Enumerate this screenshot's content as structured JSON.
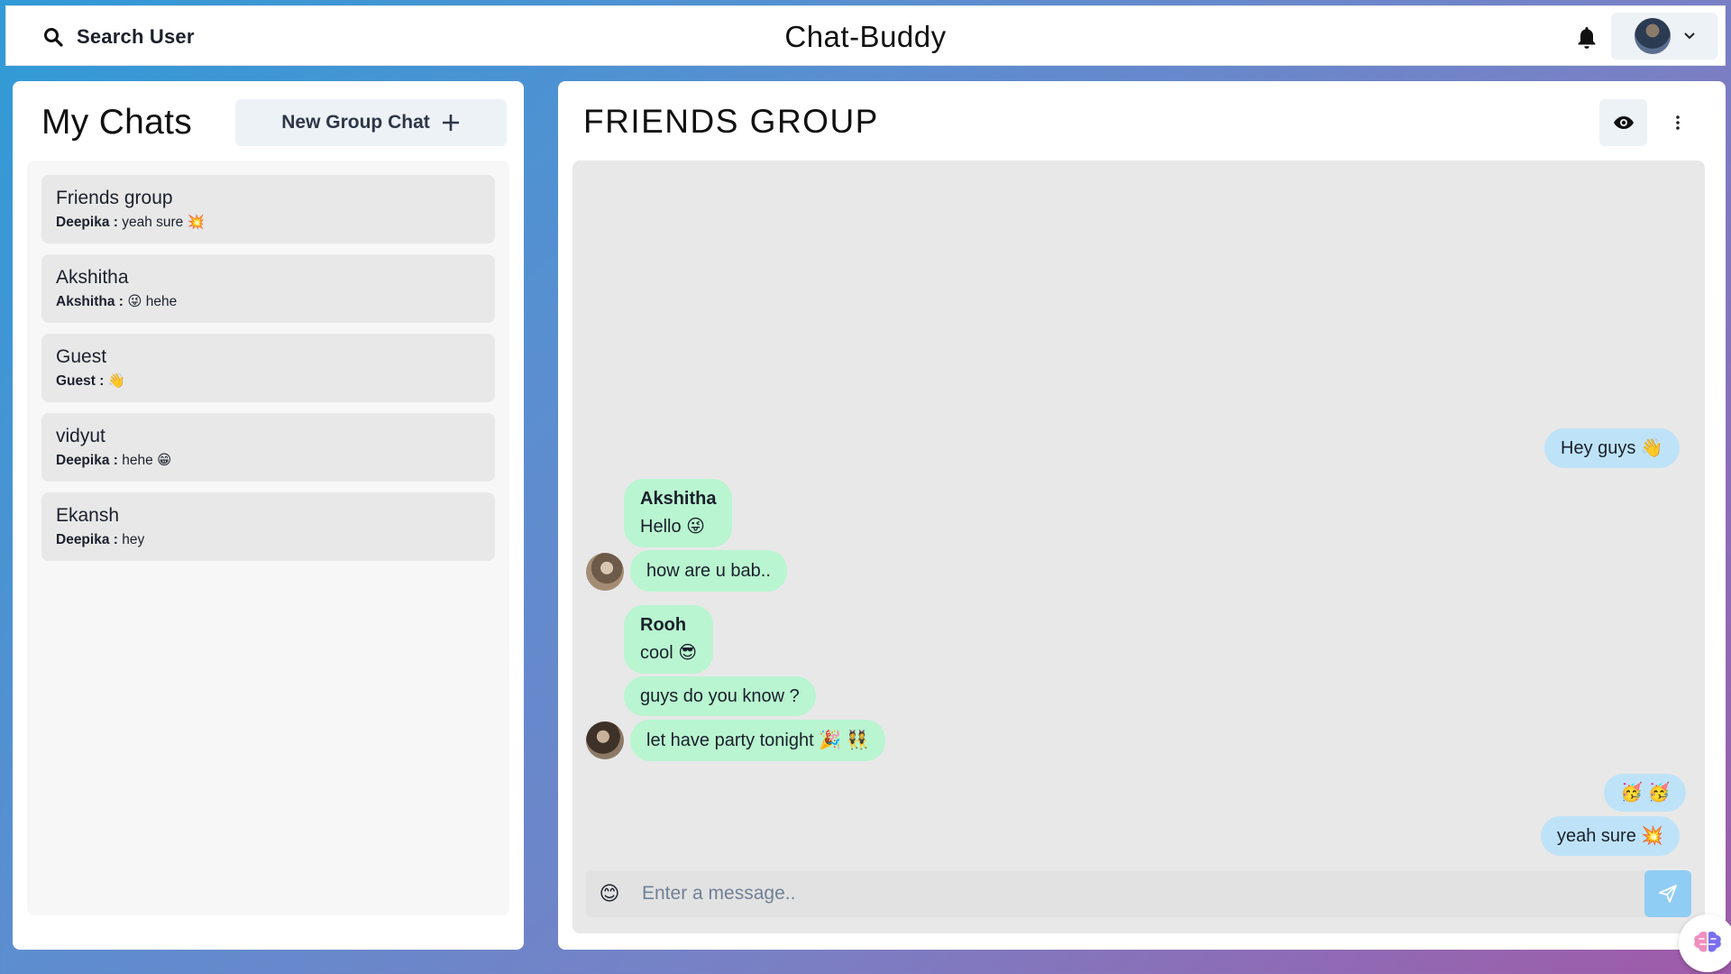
{
  "header": {
    "search_label": "Search User",
    "app_title": "Chat-Buddy"
  },
  "sidebar": {
    "title": "My Chats",
    "new_group_label": "New Group Chat",
    "chats": [
      {
        "name": "Friends group",
        "sender": "Deepika :",
        "preview": "yeah sure 💥"
      },
      {
        "name": "Akshitha",
        "sender": "Akshitha :",
        "preview": "😜 hehe"
      },
      {
        "name": "Guest",
        "sender": "Guest :",
        "preview": "👋"
      },
      {
        "name": "vidyut",
        "sender": "Deepika :",
        "preview": "hehe 😁"
      },
      {
        "name": "Ekansh",
        "sender": "Deepika :",
        "preview": "hey"
      }
    ]
  },
  "chat": {
    "title": "FRIENDS GROUP",
    "messages": [
      {
        "text": "Hey guys 👋"
      },
      {
        "author": "Akshitha",
        "text": "Hello 😜"
      },
      {
        "text": "how are u bab.."
      },
      {
        "author": "Rooh",
        "text": "cool 😎"
      },
      {
        "text": "guys do you know ?"
      },
      {
        "text": "let have party tonight 🎉 👯"
      },
      {
        "text": "🥳 🥳"
      },
      {
        "text": "yeah sure 💥"
      }
    ],
    "input_placeholder": "Enter a message..",
    "emoji_icon": "😊"
  },
  "colors": {
    "outgoing_bubble": "#bee3f8",
    "incoming_bubble": "#b9f5d0",
    "send_button": "#90cdf4"
  },
  "icons": {
    "search": "search-icon",
    "bell": "bell-icon",
    "chevron": "chevron-down-icon",
    "plus": "plus-icon",
    "eye": "eye-icon",
    "kebab": "more-vertical-icon",
    "emoji": "smiley-icon",
    "send": "send-icon",
    "fab": "brain-icon"
  }
}
